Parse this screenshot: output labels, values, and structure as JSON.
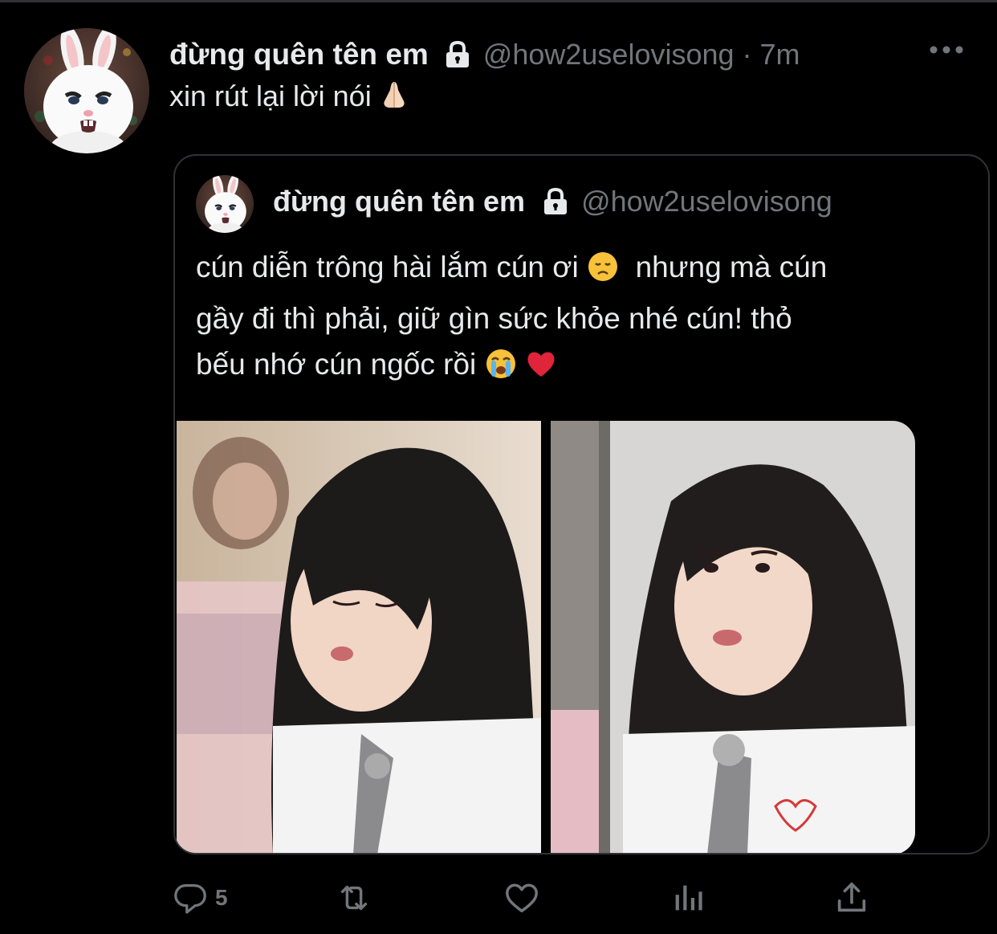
{
  "tweet": {
    "display_name": "đừng quên tên em",
    "handle": "@how2uselovisong",
    "separator": "·",
    "time": "7m",
    "text": "xin rút lại lời nói",
    "text_emoji": "🙏🏻"
  },
  "quoted": {
    "display_name": "đừng quên tên em",
    "handle": "@how2uselovisong",
    "line1a": "cún diễn trông hài lắm cún ơi",
    "emoji_sad": "😞",
    "line1b": "nhưng mà cún",
    "line2": "gầy đi thì phải, giữ gìn sức khỏe nhé cún! thỏ",
    "line3": "bếu nhớ cún ngốc rồi",
    "emoji_cry": "😭",
    "emoji_heart": "❤️"
  },
  "actions": {
    "reply_count": "5"
  },
  "colors": {
    "background": "#000000",
    "text_primary": "#e7e9ea",
    "text_secondary": "#71767b",
    "border": "#2f3336"
  },
  "icons": [
    "lock-icon",
    "more-icon",
    "reply-icon",
    "retweet-icon",
    "like-icon",
    "analytics-icon",
    "share-icon"
  ]
}
